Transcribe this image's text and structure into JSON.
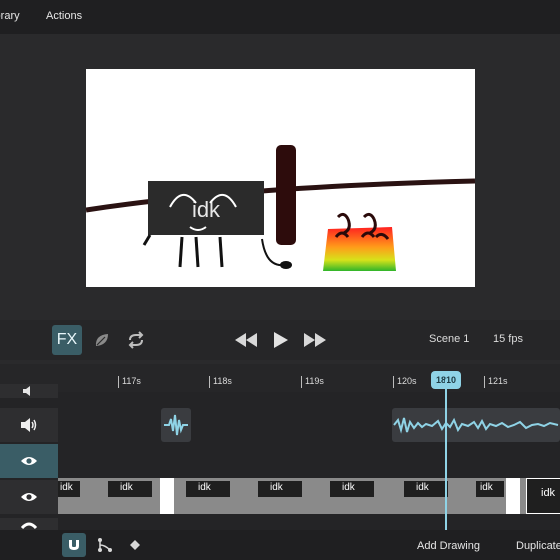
{
  "menu": {
    "library_label": "Library",
    "actions_label": "Actions"
  },
  "canvas": {
    "character_label": "idk"
  },
  "controls": {
    "fx_label": "FX",
    "scene_label": "Scene 1",
    "fps_label": "15 fps"
  },
  "ruler": {
    "ticks": [
      "117s",
      "118s",
      "119s",
      "120s",
      "121s"
    ],
    "playhead_frame": "1810"
  },
  "timeline": {
    "thumb_label": "idk"
  },
  "bottom": {
    "add_drawing_label": "Add Drawing",
    "duplicate_label": "Duplicate"
  },
  "colors": {
    "accent": "#8fd3e6",
    "panel": "#262628",
    "active": "#3a5d66"
  }
}
